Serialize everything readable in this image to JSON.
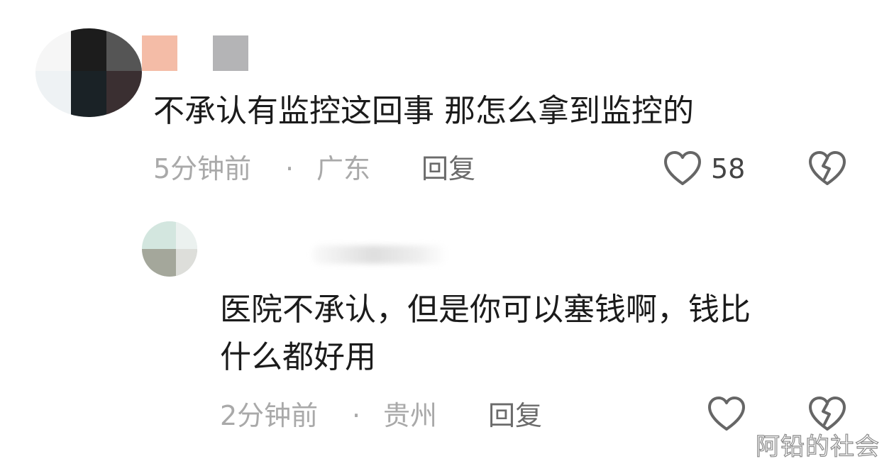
{
  "comments": [
    {
      "text": "不承认有监控这回事 那怎么拿到监控的",
      "time": "5分钟前",
      "separator": "·",
      "location": "广东",
      "reply_label": "回复",
      "like_count": "58",
      "like_icon": "heart-outline-icon",
      "dislike_icon": "broken-heart-icon"
    },
    {
      "text_line1": "医院不承认，但是你可以塞钱啊，钱比",
      "text_line2": "什么都好用",
      "time": "2分钟前",
      "separator": "·",
      "location": "贵州",
      "reply_label": "回复",
      "like_icon": "heart-outline-icon",
      "dislike_icon": "broken-heart-icon"
    }
  ],
  "watermark": "阿铅的社会",
  "colors": {
    "text": "#1b1b1b",
    "meta": "#a9a9a9",
    "reply": "#6b6b6b",
    "icon": "#666666"
  }
}
